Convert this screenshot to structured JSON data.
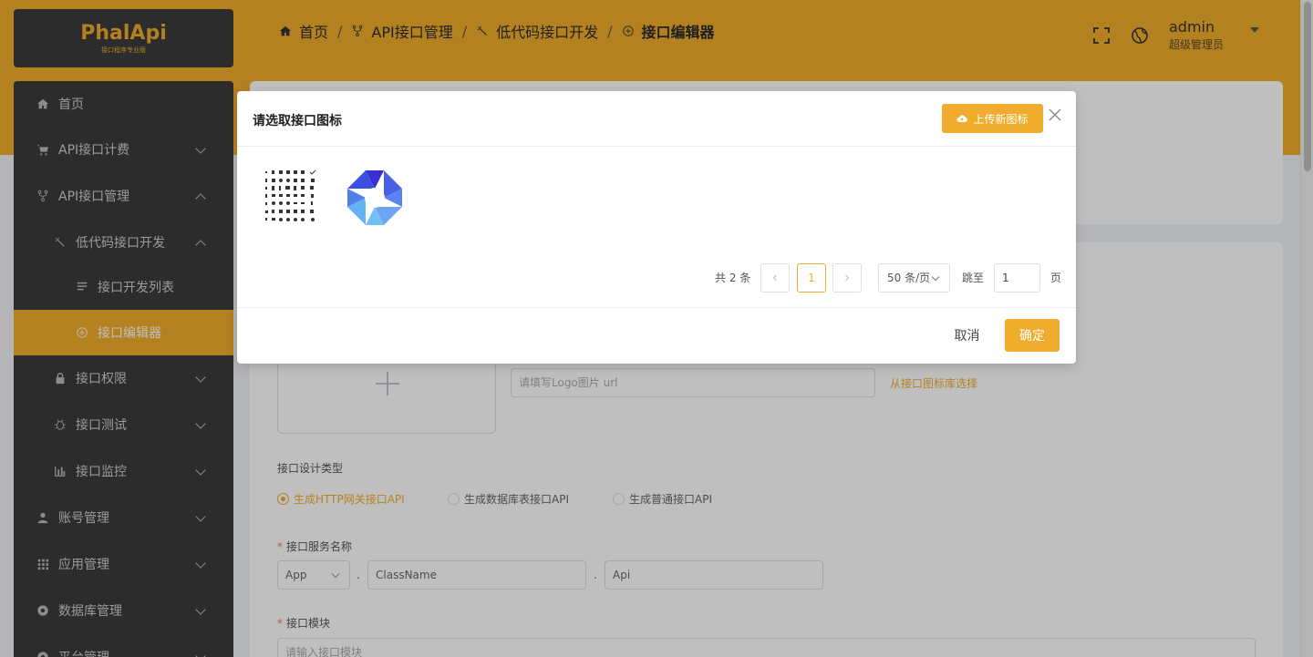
{
  "brand": {
    "logo_text": "PhalApi",
    "logo_sub": "接口程序专业版"
  },
  "breadcrumb": {
    "items": [
      "首页",
      "API接口管理",
      "低代码接口开发",
      "接口编辑器"
    ],
    "separator": "/"
  },
  "header": {
    "user_name": "admin",
    "user_role": "超级管理员"
  },
  "sidebar": {
    "items": [
      {
        "label": "首页",
        "icon": "home-icon"
      },
      {
        "label": "API接口计费",
        "icon": "cart-icon"
      },
      {
        "label": "API接口管理",
        "icon": "fork-icon"
      },
      {
        "label": "低代码接口开发",
        "icon": "wand-icon"
      },
      {
        "label": "接口开发列表",
        "icon": "list-icon"
      },
      {
        "label": "接口编辑器",
        "icon": "plus-circle-icon"
      },
      {
        "label": "接口权限",
        "icon": "lock-icon"
      },
      {
        "label": "接口测试",
        "icon": "bug-icon"
      },
      {
        "label": "接口监控",
        "icon": "bar-chart-icon"
      },
      {
        "label": "账号管理",
        "icon": "user-icon"
      },
      {
        "label": "应用管理",
        "icon": "grid-icon"
      },
      {
        "label": "数据库管理",
        "icon": "database-icon"
      },
      {
        "label": "平台管理",
        "icon": "settings-icon"
      }
    ]
  },
  "form": {
    "logo_placeholder": "请填写Logo图片 url",
    "logo_link": "从接口图标库选择",
    "design_type_label": "接口设计类型",
    "design_types": [
      "生成HTTP网关接口API",
      "生成数据库表接口API",
      "生成普通接口API"
    ],
    "service_name_label": "接口服务名称",
    "service_app": "App",
    "service_class": "ClassName",
    "service_api": "Api",
    "dot": ".",
    "module_label": "接口模块",
    "module_placeholder": "请输入接口模块"
  },
  "modal": {
    "title": "请选取接口图标",
    "upload_label": "上传新图标",
    "pagination": {
      "total": "共 2 条",
      "current_page": "1",
      "page_size": "50 条/页",
      "jump_label": "跳至",
      "jump_value": "1",
      "page_unit": "页"
    },
    "cancel_label": "取消",
    "ok_label": "确定"
  },
  "colors": {
    "accent": "#f0ad2d",
    "sidebar": "#3b3b3d"
  }
}
